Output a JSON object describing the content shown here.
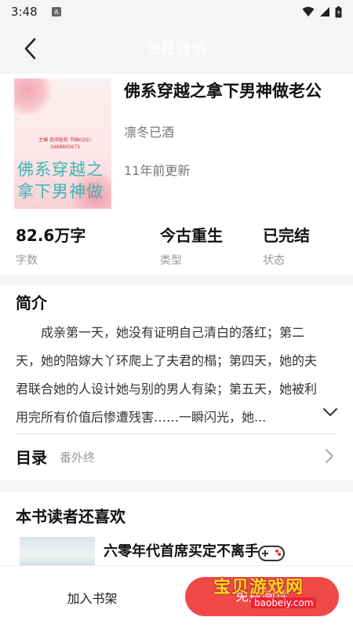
{
  "status_bar": {
    "time": "3:48",
    "notification": "A"
  },
  "header": {
    "title": "书籍详情"
  },
  "book": {
    "title": "佛系穿越之拿下男神做老公",
    "author": "凛冬已酒",
    "updated": "11年前更新",
    "cover": {
      "title": "佛系穿越之拿下男神做",
      "small_text": "主编 追阅版权 书画(QQ): 3488865675"
    }
  },
  "stats": [
    {
      "value": "82.6万字",
      "label": "字数"
    },
    {
      "value": "今古重生",
      "label": "类型"
    },
    {
      "value": "已完结",
      "label": "状态"
    }
  ],
  "intro": {
    "heading": "简介",
    "text": "成亲第一天，她没有证明自己清白的落红；第二天，她的陪嫁大丫环爬上了夫君的榻；第四天，她的夫君联合她的人设计她与别的男人有染；第五天，她被利用完所有价值后惨遭残害……一瞬闪光，她..."
  },
  "catalog": {
    "label": "目录",
    "latest": "番外终"
  },
  "recommend": {
    "heading": "本书读者还喜欢",
    "items": [
      {
        "title": "六零年代首席买定不离手"
      }
    ]
  },
  "bottom_bar": {
    "add_shelf": "加入书架",
    "read": "免费阅读"
  },
  "watermark": {
    "text": "宝贝游戏网",
    "url": "baobeiy.com"
  },
  "colors": {
    "accent": "#f04a48",
    "cover_title": "#3fb5b3",
    "background_gray": "#f5f5f5"
  }
}
